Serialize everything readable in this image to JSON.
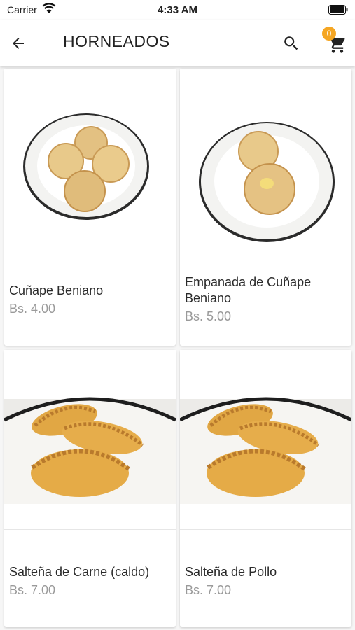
{
  "status": {
    "carrier": "Carrier",
    "time": "4:33 AM"
  },
  "header": {
    "title": "HORNEADOS",
    "cart_count": "0"
  },
  "products": [
    {
      "name": "Cuñape Beniano",
      "price": "Bs. 4.00"
    },
    {
      "name": "Empanada de Cuñape Beniano",
      "price": "Bs. 5.00"
    },
    {
      "name": "Salteña de Carne (caldo)",
      "price": "Bs. 7.00"
    },
    {
      "name": "Salteña de Pollo",
      "price": "Bs. 7.00"
    }
  ],
  "colors": {
    "badge": "#f5a623",
    "price": "#9a9a9a"
  },
  "icons": [
    "back-arrow-icon",
    "search-icon",
    "shopping-cart-icon",
    "wifi-icon",
    "battery-icon"
  ]
}
